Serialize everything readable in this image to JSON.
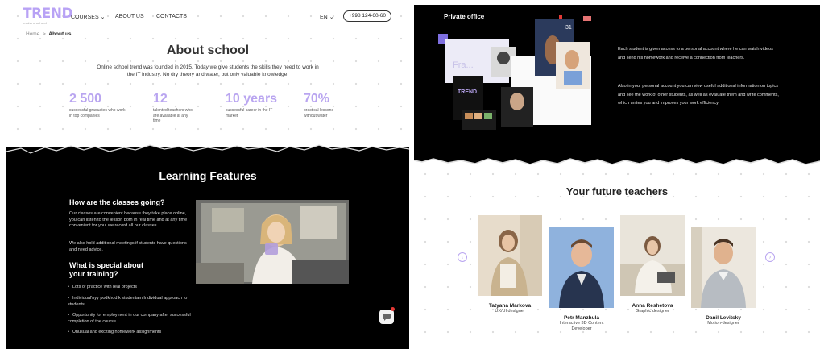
{
  "left": {
    "logo": {
      "text": "TREND",
      "sub": "modern school"
    },
    "nav": {
      "courses": "COURSES",
      "about": "ABOUT US",
      "contacts": "CONTACTS",
      "lang": "EN",
      "phone": "+998 124-60-60"
    },
    "breadcrumb": {
      "home": "Home",
      "sep": ">",
      "current": "About us"
    },
    "about": {
      "title": "About school",
      "text": "Online school trend was founded in 2015. Today we give students the skills they need to work in the IT industry. No dry theory and water, but only valuable knowledge."
    },
    "stats": [
      {
        "num": "2 500",
        "desc": "successful graduates who work in top companies"
      },
      {
        "num": "12",
        "desc": "talented teachers who are available at any time"
      },
      {
        "num": "10 years",
        "desc": "successful career in the IT market"
      },
      {
        "num": "70%",
        "desc": "practical lessons without water"
      }
    ],
    "features": {
      "title": "Learning Features",
      "h1": "How are the classes going?",
      "p1": "Our classes are convenient because they take place online, you can listen to the lesson both in real time and at any time convenient for you, we record all our classes.",
      "p2": "We also hold additional meetings if students have questions and need advice.",
      "h2a": "What is special about",
      "h2b": "your training?",
      "bullets": [
        "Lots of practice with real projects",
        "Individual'nyy podkhod k studentam Individual approach to students",
        "Opportunity for employment in our company after successful completion of the course",
        "Unusual and exciting homework assignments"
      ]
    }
  },
  "right": {
    "private_office": {
      "title": "Private office",
      "p1": "Each student is given access to a personal account where he can watch videos and send his homework and receive a connection from teachers.",
      "p2": "Also in your personal account you can view useful additional information on topics and see the work of other students, as well as evaluate them and write comments, which unites you and improves your work efficiency.",
      "collage_calendar": "31",
      "collage_text": "Fra...",
      "collage_logo": "TREND"
    },
    "teachers": {
      "title": "Your future teachers",
      "items": [
        {
          "name": "Tatyana Markova",
          "role": "UX/UI designer"
        },
        {
          "name": "Petr Manzhula",
          "role": "Interactive 3D Content Developer"
        },
        {
          "name": "Anna Reshetova",
          "role": "Graphic designer"
        },
        {
          "name": "Danil Levitsky",
          "role": "Motion-designer"
        }
      ]
    }
  }
}
